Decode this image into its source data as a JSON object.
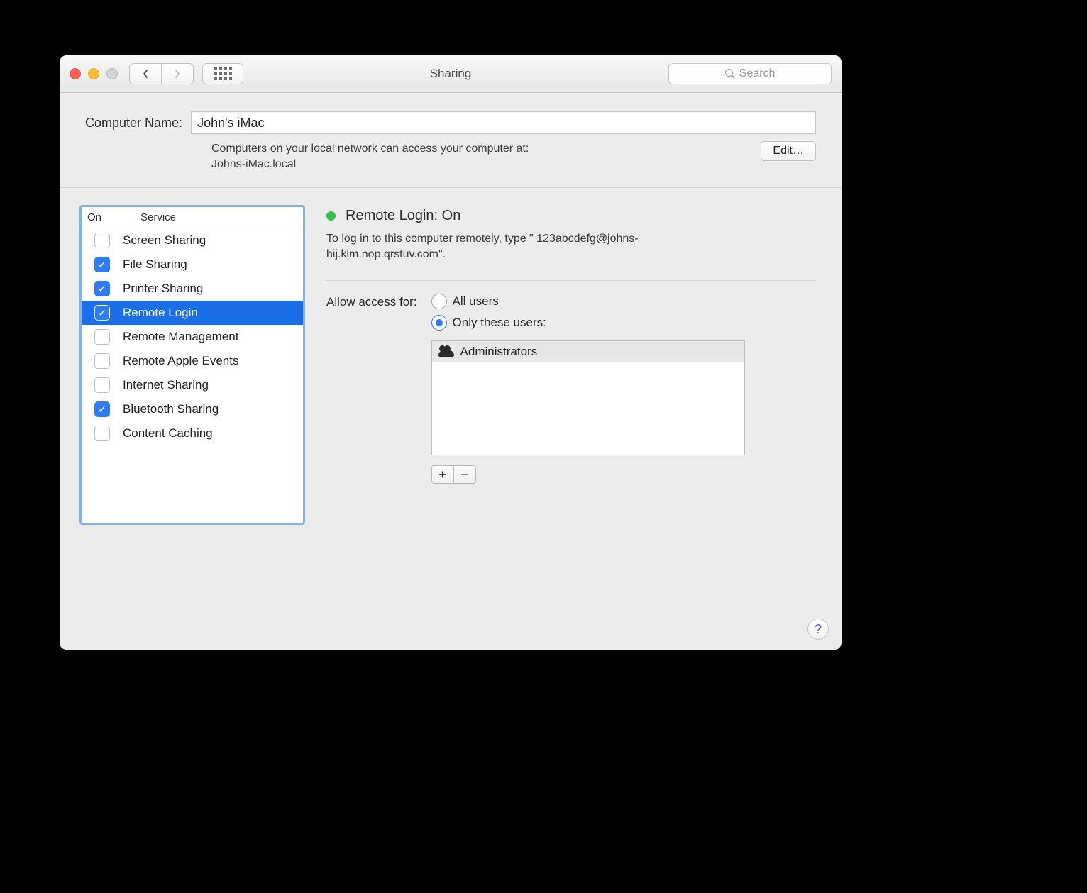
{
  "toolbar": {
    "title": "Sharing",
    "search_placeholder": "Search"
  },
  "header": {
    "computer_name_label": "Computer Name:",
    "computer_name_value": "John's iMac",
    "hint_line1": "Computers on your local network can access your computer at:",
    "hint_line2": "Johns-iMac.local",
    "edit_label": "Edit…"
  },
  "services": {
    "col_on": "On",
    "col_service": "Service",
    "items": [
      {
        "label": "Screen Sharing",
        "on": false,
        "selected": false
      },
      {
        "label": "File Sharing",
        "on": true,
        "selected": false
      },
      {
        "label": "Printer Sharing",
        "on": true,
        "selected": false
      },
      {
        "label": "Remote Login",
        "on": true,
        "selected": true
      },
      {
        "label": "Remote Management",
        "on": false,
        "selected": false
      },
      {
        "label": "Remote Apple Events",
        "on": false,
        "selected": false
      },
      {
        "label": "Internet Sharing",
        "on": false,
        "selected": false
      },
      {
        "label": "Bluetooth Sharing",
        "on": true,
        "selected": false
      },
      {
        "label": "Content Caching",
        "on": false,
        "selected": false
      }
    ]
  },
  "detail": {
    "status_title": "Remote Login: On",
    "status_help": "To log in to this computer remotely, type \" 123abcdefg@johns-hij.klm.nop.qrstuv.com\".",
    "access_label": "Allow access for:",
    "opt_all": "All users",
    "opt_only": "Only these users:",
    "selected_option": "only",
    "users": [
      {
        "label": "Administrators"
      }
    ],
    "plus": "+",
    "minus": "−"
  },
  "help": "?"
}
